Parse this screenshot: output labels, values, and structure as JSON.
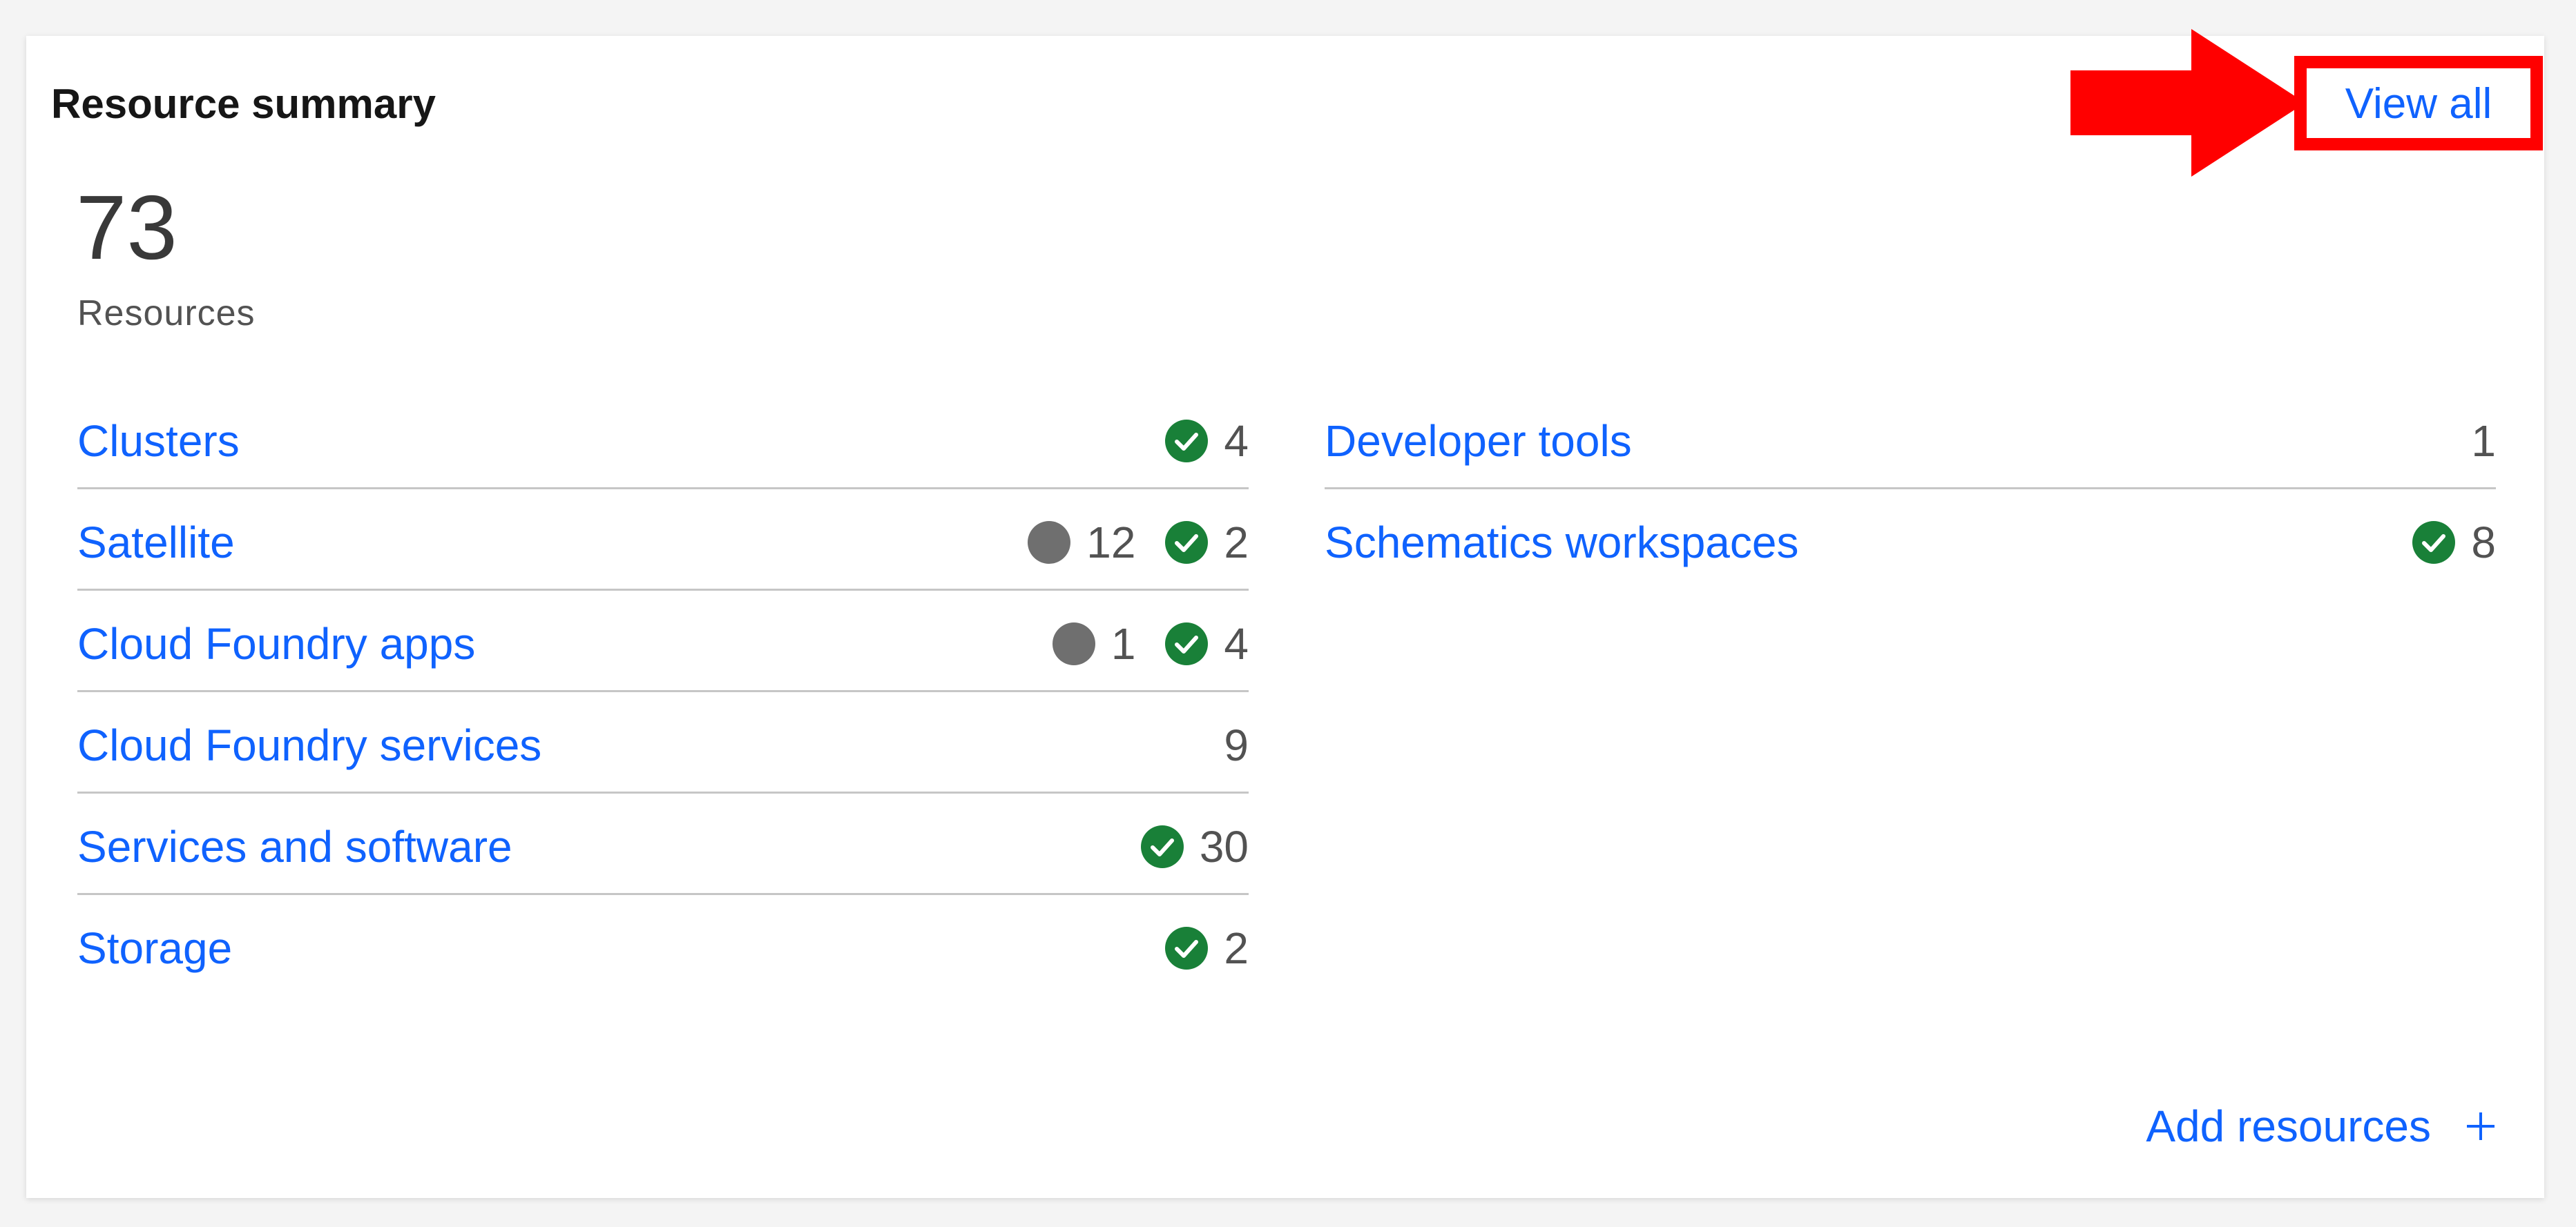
{
  "card": {
    "title": "Resource summary",
    "view_all_label": "View all",
    "total_count": "73",
    "total_label": "Resources",
    "add_resources_label": "Add resources"
  },
  "colors": {
    "link": "#0f62fe",
    "success": "#198038",
    "neutral": "#6f6f6f",
    "highlight": "#ff0000"
  },
  "left_column": [
    {
      "label": "Clusters",
      "stats": [
        {
          "status": "success",
          "count": "4"
        }
      ]
    },
    {
      "label": "Satellite",
      "stats": [
        {
          "status": "neutral",
          "count": "12"
        },
        {
          "status": "success",
          "count": "2"
        }
      ]
    },
    {
      "label": "Cloud Foundry apps",
      "stats": [
        {
          "status": "neutral",
          "count": "1"
        },
        {
          "status": "success",
          "count": "4"
        }
      ]
    },
    {
      "label": "Cloud Foundry services",
      "stats": [
        {
          "status": "none",
          "count": "9"
        }
      ]
    },
    {
      "label": "Services and software",
      "stats": [
        {
          "status": "success",
          "count": "30"
        }
      ]
    },
    {
      "label": "Storage",
      "stats": [
        {
          "status": "success",
          "count": "2"
        }
      ]
    }
  ],
  "right_column": [
    {
      "label": "Developer tools",
      "stats": [
        {
          "status": "none",
          "count": "1"
        }
      ]
    },
    {
      "label": "Schematics workspaces",
      "stats": [
        {
          "status": "success",
          "count": "8"
        }
      ]
    }
  ],
  "icons": {
    "success": "checkmark-filled-icon",
    "neutral": "status-circle-icon",
    "add": "plus-icon",
    "annotation": "red-arrow-icon"
  }
}
